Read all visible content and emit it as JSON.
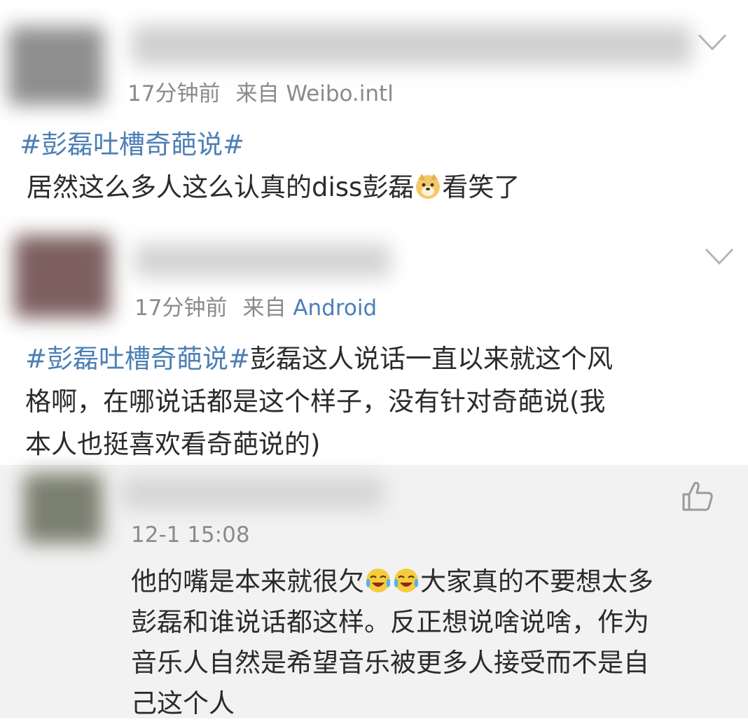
{
  "posts": [
    {
      "time": "17分钟前",
      "source_prefix": "来自",
      "source": "Weibo.intl",
      "hashtag": "#彭磊吐槽奇葩说#",
      "text_before_emoji": "居然这么多人这么认真的diss彭磊",
      "emoji": "doge-emoji",
      "text_after_emoji": "看笑了"
    },
    {
      "time": "17分钟前",
      "source_prefix": "来自",
      "source": "Android",
      "hashtag": "#彭磊吐槽奇葩说#",
      "line1_rest": "彭磊这人说话一直以来就这个风",
      "line2": "格啊，在哪说话都是这个样子，没有针对奇葩说(我",
      "line3": "本人也挺喜欢看奇葩说的)"
    }
  ],
  "reply": {
    "time": "12-1 15:08",
    "line1_before": "他的嘴是本来就很欠",
    "emoji": "laugh-cry-emoji",
    "line1_after": "大家真的不要想太多",
    "line2": "彭磊和谁说话都这样。反正想说啥说啥，作为",
    "line3": "音乐人自然是希望音乐被更多人接受而不是自",
    "line4": "己这个人"
  },
  "colors": {
    "link": "#4c7fb5",
    "meta": "#8a8a8a",
    "reply_bg": "#f2f2f2"
  }
}
